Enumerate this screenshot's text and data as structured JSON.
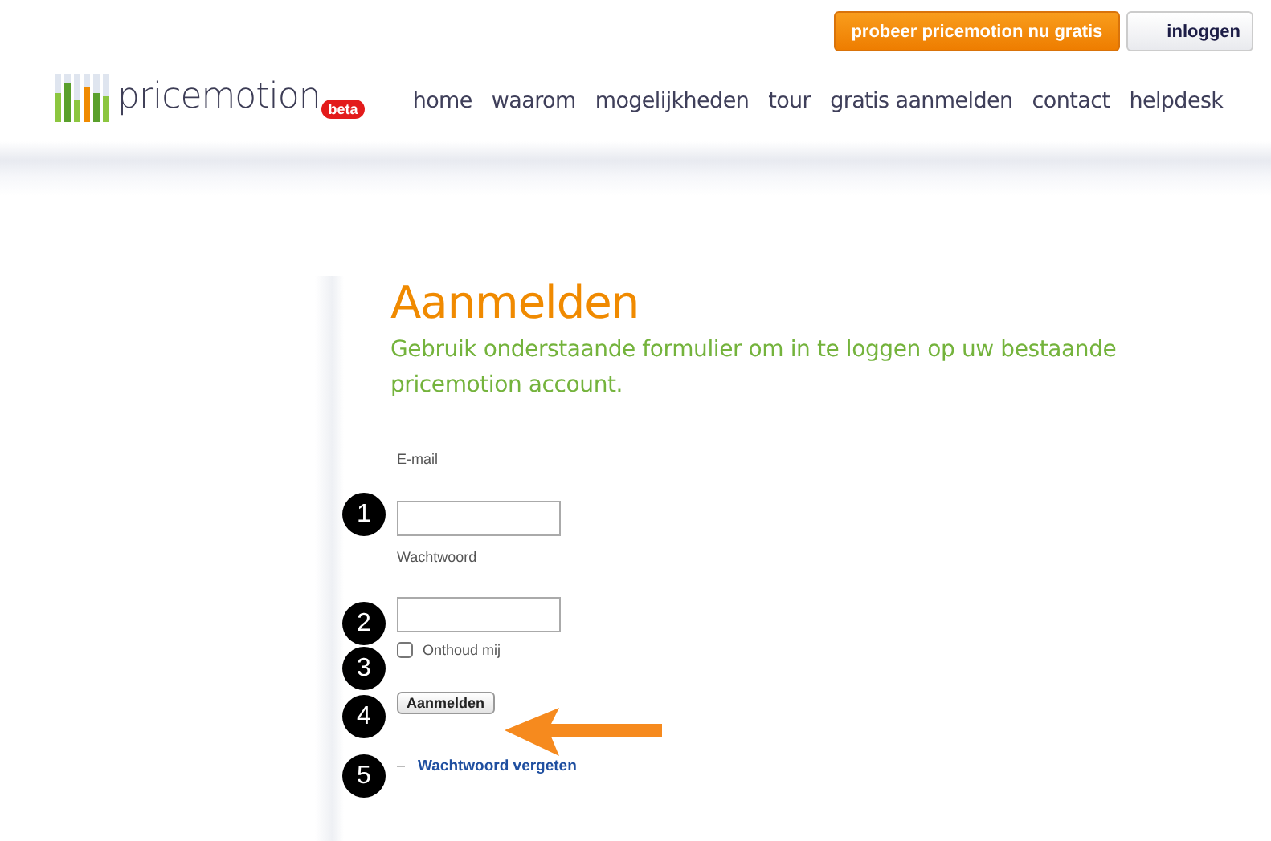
{
  "top_buttons": {
    "trial": "probeer pricemotion nu gratis",
    "login": "inloggen"
  },
  "logo": {
    "name": "pricemotion",
    "badge": "beta"
  },
  "nav": [
    {
      "label": "home"
    },
    {
      "label": "waarom"
    },
    {
      "label": "mogelijkheden"
    },
    {
      "label": "tour"
    },
    {
      "label": "gratis aanmelden"
    },
    {
      "label": "contact"
    },
    {
      "label": "helpdesk"
    }
  ],
  "form": {
    "title": "Aanmelden",
    "intro": "Gebruik onderstaande formulier om in te loggen op uw bestaande pricemotion account.",
    "email_label": "E-mail",
    "password_label": "Wachtwoord",
    "remember": {
      "label": "Onthoud mij",
      "checked": false
    },
    "submit": "Aanmelden",
    "forgot_bullet": "–",
    "forgot_link": "Wachtwoord vergeten"
  },
  "markers": [
    "1",
    "2",
    "3",
    "4",
    "5"
  ]
}
